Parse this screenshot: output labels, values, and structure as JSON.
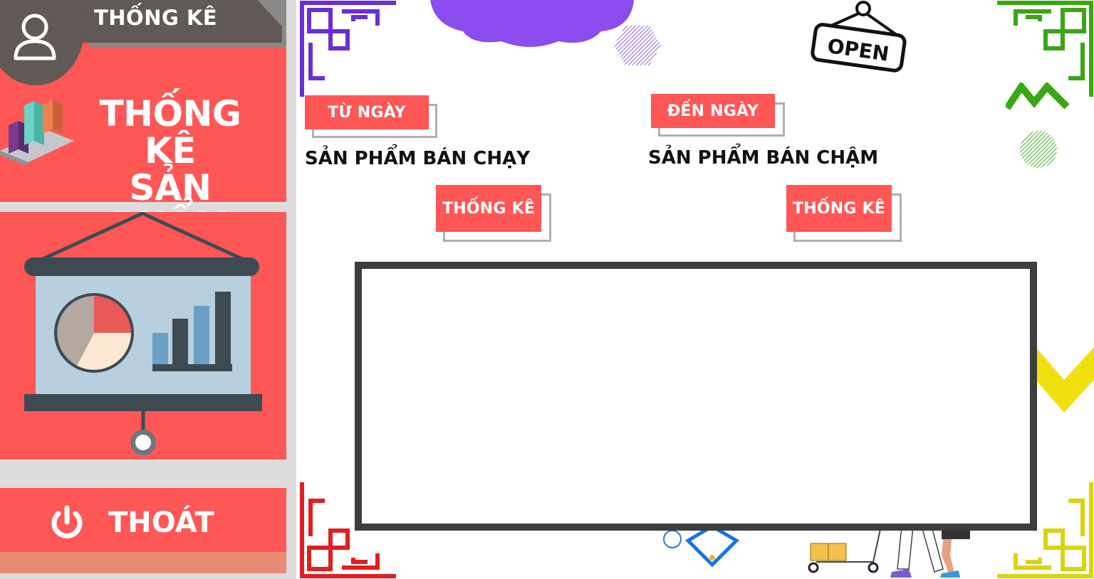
{
  "sidebar": {
    "tab_title": "THỐNG KÊ",
    "hero_title_line1": "THỐNG KÊ",
    "hero_title_line2": "SẢN PHẨM",
    "exit_label": "THOÁT"
  },
  "main": {
    "from_date_button": "TỪ NGÀY",
    "to_date_button": "ĐẾN NGÀY",
    "best_selling_label": "SẢN PHẨM BÁN CHẠY",
    "slow_selling_label": "SẢN PHẨM BÁN CHẬM",
    "stat_button_left": "THỐNG KÊ",
    "stat_button_right": "THỐNG KÊ",
    "open_sign": "OPEN"
  },
  "colors": {
    "accent": "#ff5656",
    "tab": "#615956",
    "frame": "#3e3e3e",
    "sidebar_gray": "#dcdcdc"
  }
}
